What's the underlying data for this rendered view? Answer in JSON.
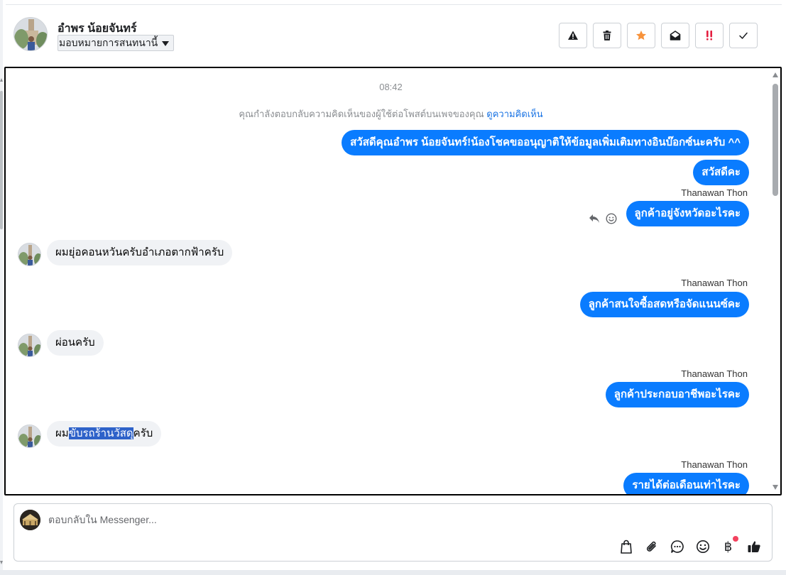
{
  "header": {
    "customer_name": "อำพร น้อยจันทร์",
    "assign_label": "มอบหมายการสนทนานี้",
    "actions": [
      {
        "name": "report-button",
        "icon": "warning-icon"
      },
      {
        "name": "delete-button",
        "icon": "trash-icon"
      },
      {
        "name": "star-button",
        "icon": "star-icon"
      },
      {
        "name": "mark-unread-button",
        "icon": "envelope-open-icon"
      },
      {
        "name": "important-button",
        "icon": "double-exclamation-icon"
      },
      {
        "name": "done-button",
        "icon": "checkmark-icon"
      }
    ]
  },
  "colors": {
    "outgoing_bubble": "#0a7cff",
    "incoming_bubble": "#f0f2f5",
    "link": "#1b74e4",
    "star": "#f7923b",
    "important": "#e41e3f"
  },
  "chat": {
    "timestamp": "08:42",
    "notice_text": "คุณกำลังตอบกลับความคิดเห็นของผู้ใช้ต่อโพสต์บนเพจของคุณ",
    "notice_link": "ดูความคิดเห็น",
    "messages": [
      {
        "direction": "out",
        "text": "สวัสดีคุณอำพร น้อยจันทร์!น้องโชคขออนุญาติให้ข้อมูลเพิ่มเติมทางอินบ๊อกซ์นะครับ ^^"
      },
      {
        "direction": "out",
        "text": "สวัสดีคะ"
      },
      {
        "direction": "out",
        "sender": "Thanawan Thon",
        "text": "ลูกค้าอยู่จังหวัดอะไรคะ"
      },
      {
        "direction": "in",
        "text": "ผมยุ่อคอนหวันครับอำเภอตากฟ้าครับ"
      },
      {
        "direction": "out",
        "sender": "Thanawan Thon",
        "text": "ลูกค้าสนใจซื้อสดหรือจัดแนนซ์คะ"
      },
      {
        "direction": "in",
        "text": "ผ่อนครับ"
      },
      {
        "direction": "out",
        "sender": "Thanawan Thon",
        "text": "ลูกค้าประกอบอาชีพอะไรคะ"
      },
      {
        "direction": "in",
        "text_before": "ผม",
        "text_selected": "ขับรถร้านวัสดุ",
        "text_after": "ครับ"
      },
      {
        "direction": "out",
        "sender": "Thanawan Thon",
        "text": "รายได้ต่อเดือนเท่าไรคะ"
      }
    ]
  },
  "composer": {
    "placeholder": "ตอบกลับใน Messenger...",
    "value": "",
    "tools": [
      "shopping-bag-icon",
      "paperclip-icon",
      "saved-reply-icon",
      "emoji-icon",
      "baht-payment-icon",
      "like-icon"
    ],
    "baht_symbol": "฿"
  }
}
